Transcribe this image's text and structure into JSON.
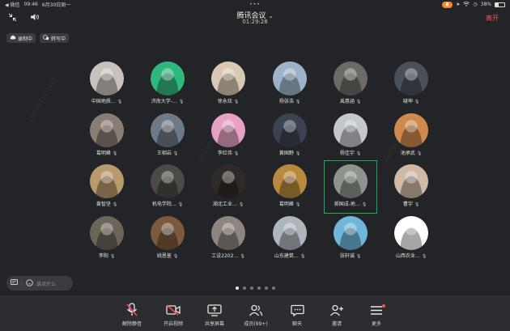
{
  "status_bar": {
    "back_app": "◀ 微信",
    "time": "09:46",
    "date": "6月30日周一",
    "battery": "38%",
    "battery_level": 0.38
  },
  "header": {
    "title": "腾讯会议",
    "timer": "01:29:28",
    "leave_label": "离开"
  },
  "chips": {
    "recording": "录制中",
    "transcribing": "转写中"
  },
  "participants": [
    {
      "name": "中国地质…",
      "color": "#c9c2bc"
    },
    {
      "name": "济南大学-…",
      "color": "#2fb87c"
    },
    {
      "name": "徐永炫",
      "color": "#d9c9b4"
    },
    {
      "name": "杨张浩",
      "color": "#9fb3c8"
    },
    {
      "name": "禹惠涵",
      "color": "#6d6a66"
    },
    {
      "name": "啵坤",
      "color": "#4a4f5a"
    },
    {
      "name": "葛明峰",
      "color": "#8a7d74"
    },
    {
      "name": "王相岩",
      "color": "#6e7a86"
    },
    {
      "name": "李红伟",
      "color": "#e6a1c4"
    },
    {
      "name": "黄国野",
      "color": "#3b4350"
    },
    {
      "name": "杨佳宇",
      "color": "#c4c8cc"
    },
    {
      "name": "池承武",
      "color": "#d08a4e"
    },
    {
      "name": "黄智坚",
      "color": "#b89a6c"
    },
    {
      "name": "机电学院…",
      "color": "#4c4a45"
    },
    {
      "name": "湖北工业…",
      "color": "#2f2a27"
    },
    {
      "name": "葛明峰",
      "color": "#b88a3f"
    },
    {
      "name": "郝国成-地…",
      "color": "#8e948c"
    },
    {
      "name": "曹宇",
      "color": "#cfb9a7"
    },
    {
      "name": "李阳",
      "color": "#6b6658"
    },
    {
      "name": "姚恩鉴",
      "color": "#7c5a3e"
    },
    {
      "name": "工设2202…",
      "color": "#8d857f"
    },
    {
      "name": "山东建筑…",
      "color": "#aeb6bd"
    },
    {
      "name": "张轩诚",
      "color": "#6fb7d8"
    },
    {
      "name": "山西农业…",
      "color": "#ffffff"
    }
  ],
  "active_index": 16,
  "chat": {
    "placeholder": "说点什么"
  },
  "pagination": {
    "total": 6,
    "current": 1
  },
  "toolbar": {
    "unmute": "解除静音",
    "start_video": "开启视频",
    "share_screen": "共享屏幕",
    "members": "成员(99+)",
    "chat": "聊天",
    "invite": "邀请",
    "more": "更多"
  },
  "colors": {
    "accent_green": "#1aad5a",
    "leave_red": "#ff5050",
    "mic_orange": "#f08a24"
  }
}
